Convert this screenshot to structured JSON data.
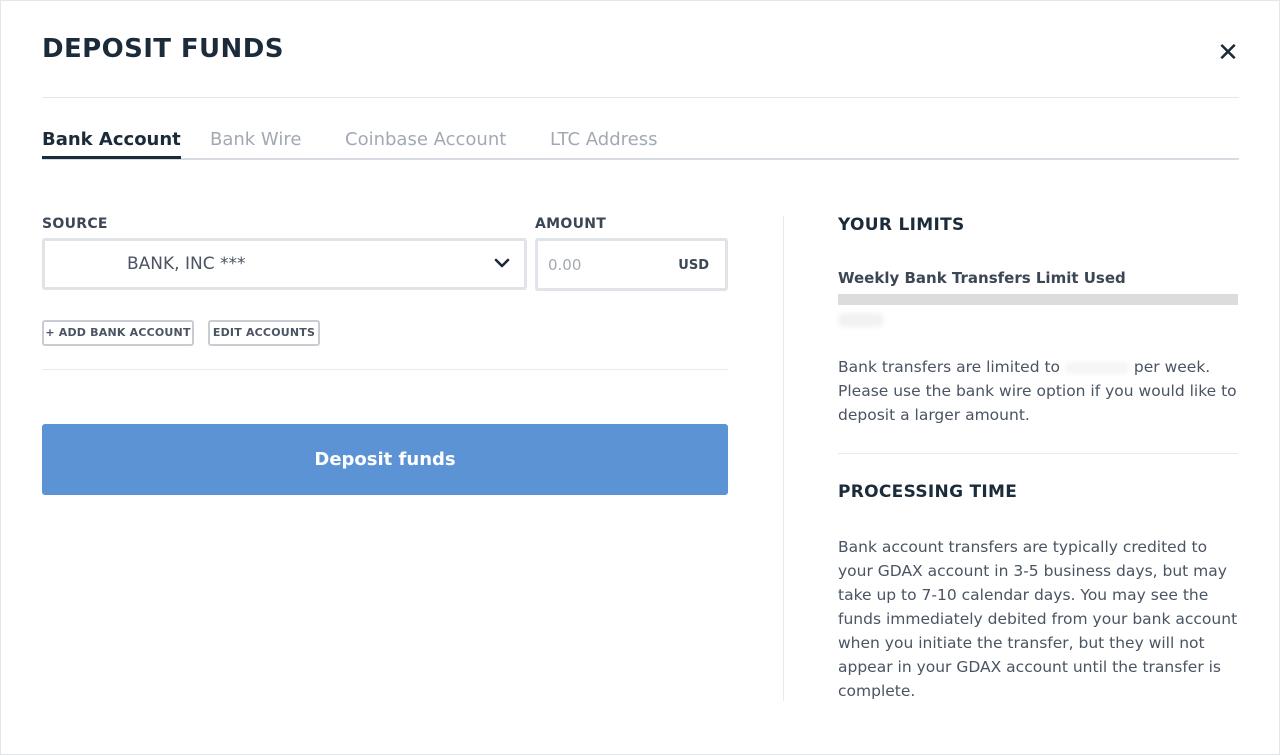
{
  "modal": {
    "title": "DEPOSIT FUNDS",
    "close_icon": "close-icon"
  },
  "tabs": [
    {
      "label": "Bank Account",
      "active": true
    },
    {
      "label": "Bank Wire",
      "active": false
    },
    {
      "label": "Coinbase Account",
      "active": false
    },
    {
      "label": "LTC Address",
      "active": false
    }
  ],
  "form": {
    "source_label": "SOURCE",
    "source_value": "BANK, INC ***",
    "source_icon": "chevron-down-icon",
    "amount_label": "AMOUNT",
    "amount_placeholder": "0.00",
    "amount_value": "",
    "currency": "USD",
    "add_bank_label": "+ ADD BANK ACCOUNT",
    "edit_accounts_label": "EDIT ACCOUNTS",
    "deposit_label": "Deposit funds"
  },
  "limits": {
    "heading": "YOUR LIMITS",
    "weekly_label": "Weekly Bank Transfers Limit Used",
    "weekly_used_fraction": 0,
    "info_pre": "Bank transfers are limited to",
    "info_post": "per week. Please use the bank wire option if you would like to deposit a larger amount."
  },
  "processing": {
    "heading": "PROCESSING TIME",
    "text": "Bank account transfers are typically credited to your GDAX account in 3-5 business days, but may take up to 7-10 calendar days. You may see the funds immediately debited from your bank account when you initiate the transfer, but they will not appear in your GDAX account until the transfer is complete."
  },
  "colors": {
    "accent": "#5b93d5",
    "text_dark": "#1c2b3a",
    "tab_inactive": "#a3a9b2"
  }
}
